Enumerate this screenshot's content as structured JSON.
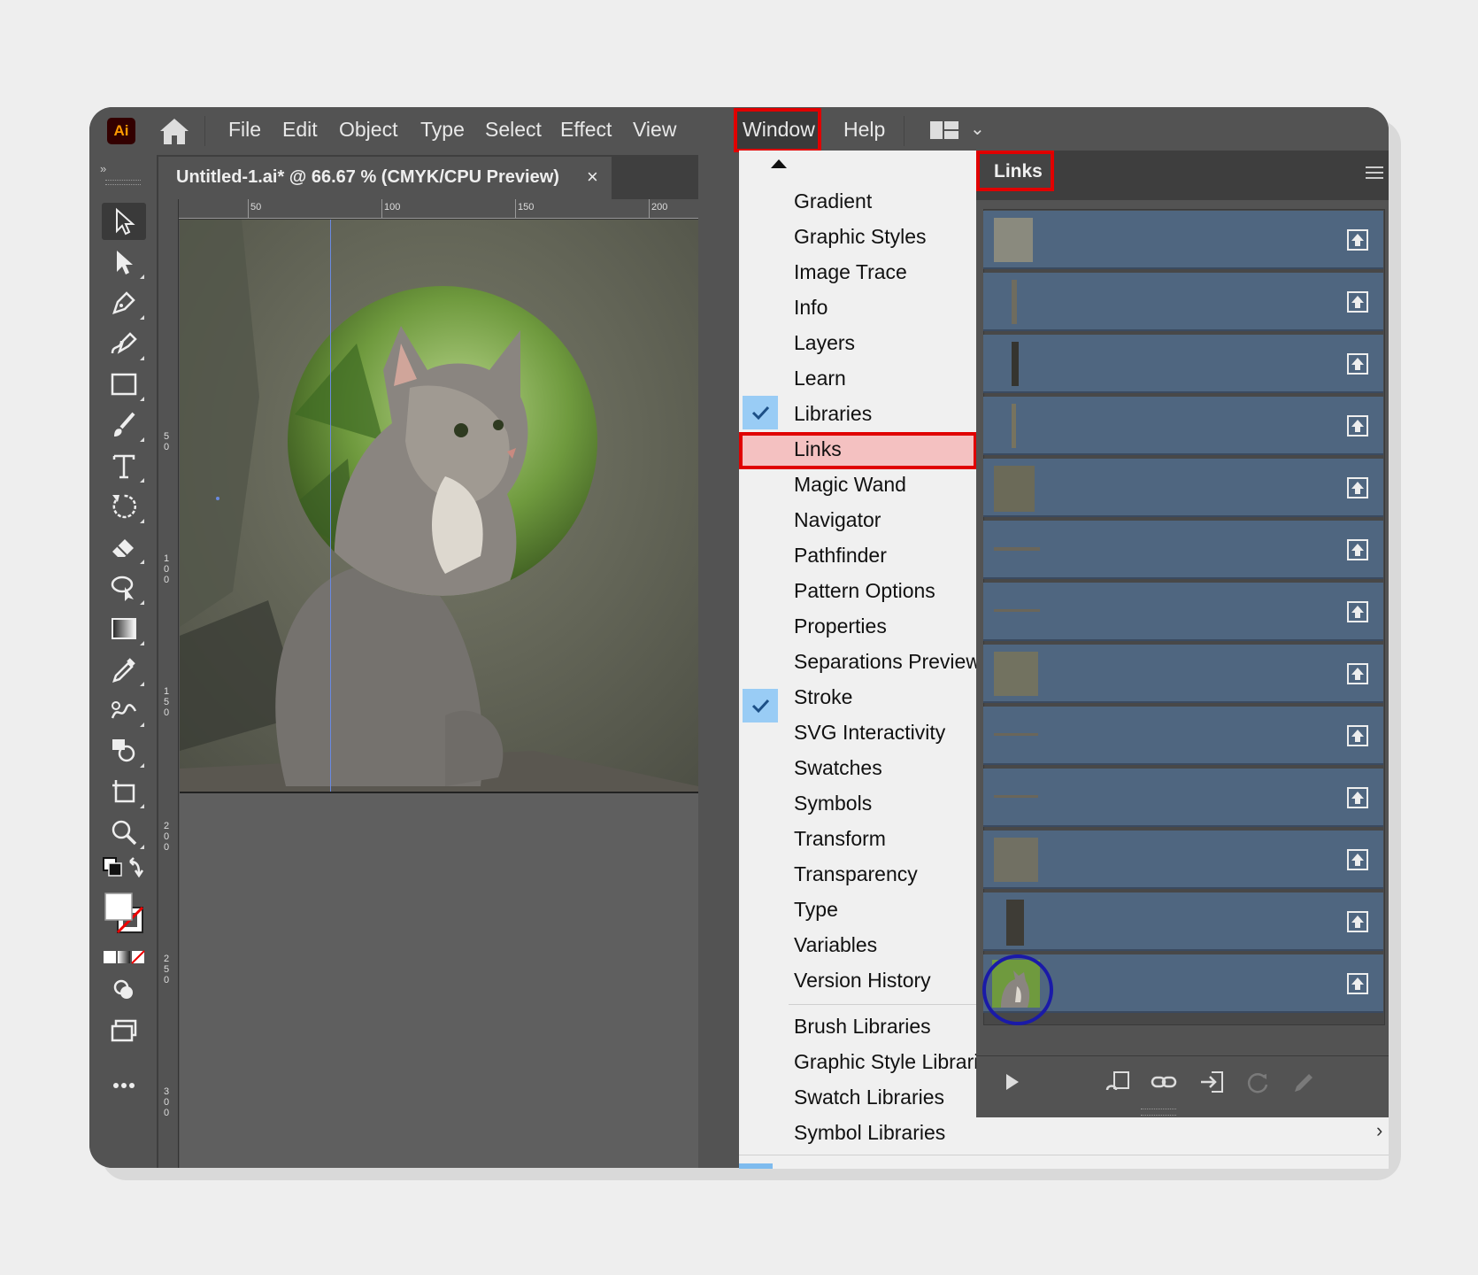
{
  "menubar": {
    "logo": "Ai",
    "items": [
      "File",
      "Edit",
      "Object",
      "Type",
      "Select",
      "Effect",
      "View",
      "Window",
      "Help"
    ]
  },
  "document": {
    "title": "Untitled-1.ai* @ 66.67 % (CMYK/CPU Preview)",
    "close": "×",
    "ruler_top": [
      "50",
      "100",
      "150",
      "200"
    ],
    "ruler_left": [
      "5\n0",
      "1\n0\n0",
      "1\n5\n0",
      "2\n0\n0",
      "2\n5\n0",
      "3\n0\n0"
    ]
  },
  "window_menu": {
    "items": [
      {
        "label": "Gradient",
        "checked": false
      },
      {
        "label": "Graphic Styles",
        "checked": false
      },
      {
        "label": "Image Trace",
        "checked": false
      },
      {
        "label": "Info",
        "checked": false
      },
      {
        "label": "Layers",
        "checked": false
      },
      {
        "label": "Learn",
        "checked": false
      },
      {
        "label": "Libraries",
        "checked": true
      },
      {
        "label": "Links",
        "checked": false,
        "highlighted": true
      },
      {
        "label": "Magic Wand",
        "checked": false
      },
      {
        "label": "Navigator",
        "checked": false
      },
      {
        "label": "Pathfinder",
        "checked": true
      },
      {
        "label": "Pattern Options",
        "checked": false
      },
      {
        "label": "Properties",
        "checked": false
      },
      {
        "label": "Separations Preview",
        "checked": false
      },
      {
        "label": "Stroke",
        "checked": false
      },
      {
        "label": "SVG Interactivity",
        "checked": false
      },
      {
        "label": "Swatches",
        "checked": false
      },
      {
        "label": "Symbols",
        "checked": false
      },
      {
        "label": "Transform",
        "checked": false
      },
      {
        "label": "Transparency",
        "checked": false
      },
      {
        "label": "Type",
        "checked": false
      },
      {
        "label": "Variables",
        "checked": false
      },
      {
        "label": "Version History",
        "checked": false
      }
    ],
    "libraries": [
      "Brush Libraries",
      "Graphic Style Librarie",
      "Swatch Libraries",
      "Symbol Libraries"
    ],
    "submenu_arrow": "›"
  },
  "links_panel": {
    "tab": "Links",
    "row_count": 13,
    "highlight_color": "#e00000",
    "circle_color": "#1a1aa8",
    "row_color": "#4f6680"
  }
}
